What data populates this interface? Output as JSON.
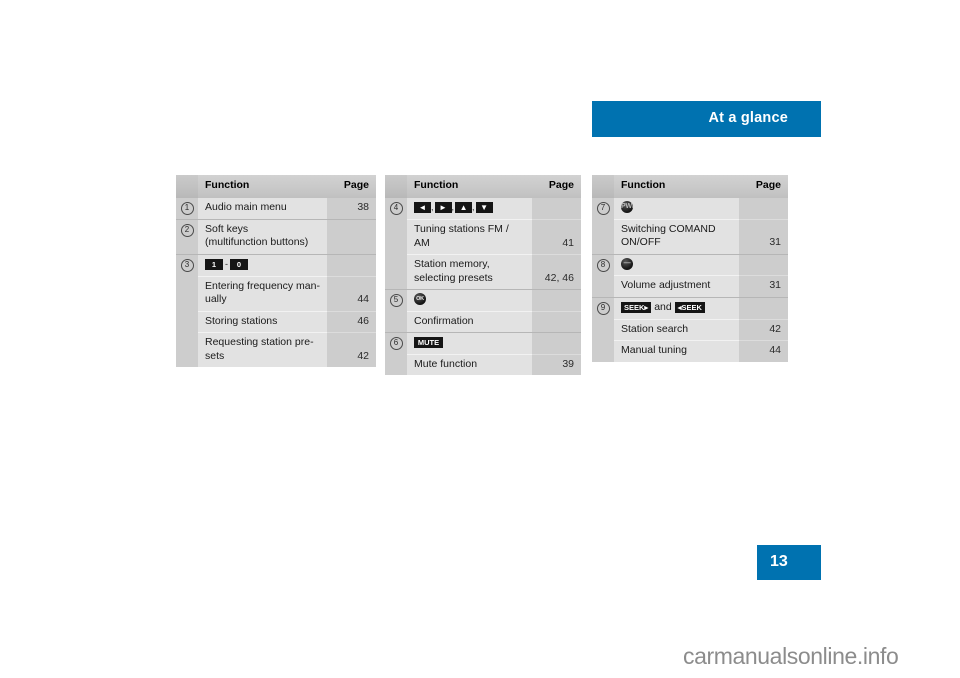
{
  "header": {
    "title": "At a glance",
    "accent_color": "#0072b0"
  },
  "page_tab": {
    "number": "13"
  },
  "watermark": {
    "text": "carmanualsonline.info"
  },
  "tables": [
    {
      "id": "table-1",
      "headers": {
        "index": "",
        "function": "Function",
        "page": "Page"
      },
      "rows": [
        {
          "index": "1",
          "glyphs": [],
          "lines": [
            {
              "text": "Audio main menu",
              "page": "38"
            }
          ]
        },
        {
          "index": "2",
          "glyphs": [],
          "lines": [
            {
              "text": "Soft keys\n(multifunction buttons)",
              "page": ""
            }
          ]
        },
        {
          "index": "3",
          "glyphs": [
            {
              "type": "key",
              "label": "1",
              "name": "number-key-1"
            },
            {
              "type": "sep",
              "label": "-",
              "name": "range-dash"
            },
            {
              "type": "key",
              "label": "0",
              "name": "number-key-0"
            }
          ],
          "lines": [
            {
              "text": "Entering frequency man-\nually",
              "page": "44"
            },
            {
              "text": "Storing stations",
              "page": "46"
            },
            {
              "text": "Requesting station pre-\nsets",
              "page": "42"
            }
          ]
        }
      ]
    },
    {
      "id": "table-2",
      "headers": {
        "index": "",
        "function": "Function",
        "page": "Page"
      },
      "rows": [
        {
          "index": "4",
          "glyphs": [
            {
              "type": "arrow",
              "label": "◄",
              "name": "arrow-left-key"
            },
            {
              "type": "comma",
              "label": ",",
              "name": "comma-separator"
            },
            {
              "type": "arrow",
              "label": "►",
              "name": "arrow-right-key"
            },
            {
              "type": "comma",
              "label": ",",
              "name": "comma-separator"
            },
            {
              "type": "arrow",
              "label": "▲",
              "name": "arrow-up-key"
            },
            {
              "type": "comma",
              "label": ",",
              "name": "comma-separator"
            },
            {
              "type": "arrow",
              "label": "▼",
              "name": "arrow-down-key"
            }
          ],
          "lines": [
            {
              "text": "Tuning stations FM / AM",
              "page": "41"
            },
            {
              "text": "Station memory,\nselecting presets",
              "page": "42, 46"
            }
          ]
        },
        {
          "index": "5",
          "glyphs": [
            {
              "type": "round",
              "label": "OK",
              "name": "ok-button-icon"
            }
          ],
          "lines": [
            {
              "text": "Confirmation",
              "page": ""
            }
          ]
        },
        {
          "index": "6",
          "glyphs": [
            {
              "type": "keywide",
              "label": "MUTE",
              "name": "mute-key"
            }
          ],
          "lines": [
            {
              "text": "Mute function",
              "page": "39"
            }
          ]
        }
      ]
    },
    {
      "id": "table-3",
      "headers": {
        "index": "",
        "function": "Function",
        "page": "Page"
      },
      "rows": [
        {
          "index": "7",
          "glyphs": [
            {
              "type": "round",
              "label": "PWR",
              "name": "power-knob-icon"
            }
          ],
          "lines": [
            {
              "text": "Switching COMAND\nON/OFF",
              "page": "31"
            }
          ]
        },
        {
          "index": "8",
          "glyphs": [
            {
              "type": "round",
              "label": "—",
              "name": "volume-knob-icon"
            }
          ],
          "lines": [
            {
              "text": "Volume adjustment",
              "page": "31"
            }
          ]
        },
        {
          "index": "9",
          "glyphs": [
            {
              "type": "keywide",
              "label": "SEEK▸",
              "name": "seek-forward-key"
            },
            {
              "type": "and",
              "label": "and",
              "name": "and-separator"
            },
            {
              "type": "keywide",
              "label": "◂SEEK",
              "name": "seek-back-key"
            }
          ],
          "lines": [
            {
              "text": "Station search",
              "page": "42"
            },
            {
              "text": "Manual tuning",
              "page": "44"
            }
          ]
        }
      ]
    }
  ]
}
